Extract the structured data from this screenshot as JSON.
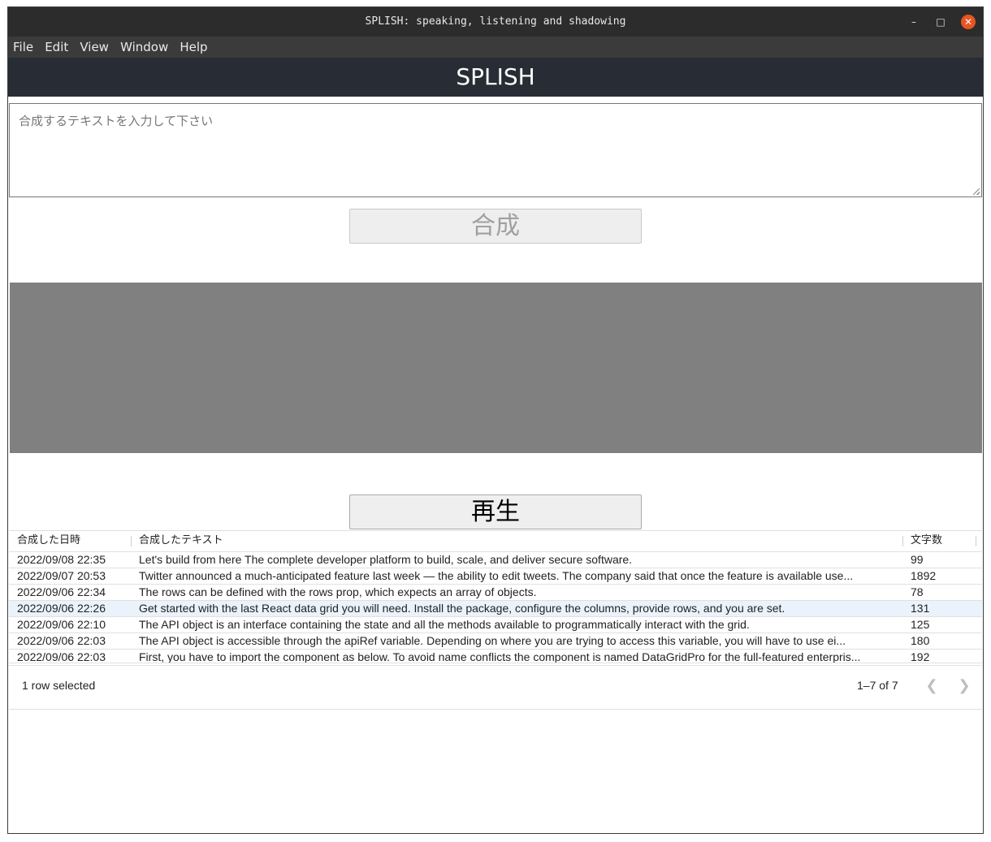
{
  "window": {
    "title": "SPLISH: speaking, listening and shadowing",
    "controls": [
      "minimize-icon",
      "maximize-icon",
      "close-icon"
    ]
  },
  "menu": {
    "items": [
      "File",
      "Edit",
      "View",
      "Window",
      "Help"
    ]
  },
  "app": {
    "title": "SPLISH"
  },
  "input": {
    "placeholder": "合成するテキストを入力して下さい",
    "value": ""
  },
  "buttons": {
    "synthesize": "合成",
    "play": "再生"
  },
  "grid": {
    "columns": [
      "合成した日時",
      "合成したテキスト",
      "文字数"
    ],
    "rows": [
      {
        "date": "2022/09/08 22:35",
        "text": "Let's build from here The complete developer platform to build, scale, and deliver secure software.",
        "count": "99",
        "selected": false
      },
      {
        "date": "2022/09/07 20:53",
        "text": "Twitter announced a much-anticipated feature last week — the ability to edit tweets. The company said that once the feature is available use...",
        "count": "1892",
        "selected": false
      },
      {
        "date": "2022/09/06 22:34",
        "text": "The rows can be defined with the rows prop, which expects an array of objects.",
        "count": "78",
        "selected": false
      },
      {
        "date": "2022/09/06 22:26",
        "text": "Get started with the last React data grid you will need. Install the package, configure the columns, provide rows, and you are set.",
        "count": "131",
        "selected": true
      },
      {
        "date": "2022/09/06 22:10",
        "text": "The API object is an interface containing the state and all the methods available to programmatically interact with the grid.",
        "count": "125",
        "selected": false
      },
      {
        "date": "2022/09/06 22:03",
        "text": "The API object is accessible through the apiRef variable. Depending on where you are trying to access this variable, you will have to use ei...",
        "count": "180",
        "selected": false
      },
      {
        "date": "2022/09/06 22:03",
        "text": "First, you have to import the component as below. To avoid name conflicts the component is named DataGridPro for the full-featured enterpris...",
        "count": "192",
        "selected": false
      }
    ],
    "footer": {
      "selection": "1 row selected",
      "range": "1–7 of 7"
    }
  },
  "colors": {
    "titlebar": "#2c2c2c",
    "menubar": "#3b3b3b",
    "appbar": "#282c34",
    "output": "#808080",
    "close": "#e95420",
    "selected_row": "#eaf2fb"
  }
}
